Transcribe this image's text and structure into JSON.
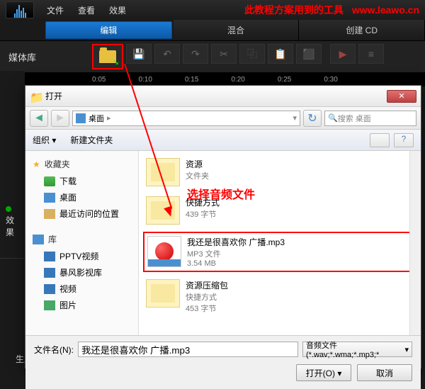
{
  "menu": {
    "file": "文件",
    "view": "查看",
    "effect": "效果"
  },
  "banner": {
    "text": "此教程方案用到的工具",
    "url": "www.leawo.cn"
  },
  "tabs": {
    "edit": "编辑",
    "mix": "混合",
    "create_cd": "创建 CD"
  },
  "sidebar_label": "媒体库",
  "ruler": [
    "0:05",
    "0:10",
    "0:15",
    "0:20",
    "0:25",
    "0:30"
  ],
  "left_panel": {
    "effects": "效果",
    "generate": "生成"
  },
  "dialog": {
    "title": "打开",
    "breadcrumb": {
      "location": "桌面"
    },
    "search_placeholder": "搜索 桌面",
    "toolbar": {
      "organize": "组织 ▾",
      "new_folder": "新建文件夹"
    },
    "sidebar": {
      "favorites": "收藏夹",
      "downloads": "下载",
      "desktop": "桌面",
      "recent": "最近访问的位置",
      "library": "库",
      "pptv": "PPTV视频",
      "storm": "暴风影视库",
      "video": "视频",
      "pictures": "图片"
    },
    "files": {
      "f1": {
        "name": "资源",
        "type": "文件夹"
      },
      "f2": {
        "name": "快捷方式",
        "meta": "439 字节"
      },
      "f3": {
        "name": "我还是很喜欢你 广播.mp3",
        "type": "MP3 文件",
        "size": "3.54 MB"
      },
      "f4": {
        "name": "资源压缩包",
        "type": "快捷方式",
        "meta": "453 字节"
      }
    },
    "annotation": "选择音频文件",
    "footer": {
      "filename_label": "文件名(N):",
      "filename_value": "我还是很喜欢你 广播.mp3",
      "filetype": "音频文件(*.wav;*.wma;*.mp3;*",
      "open": "打开(O)",
      "cancel": "取消"
    }
  }
}
